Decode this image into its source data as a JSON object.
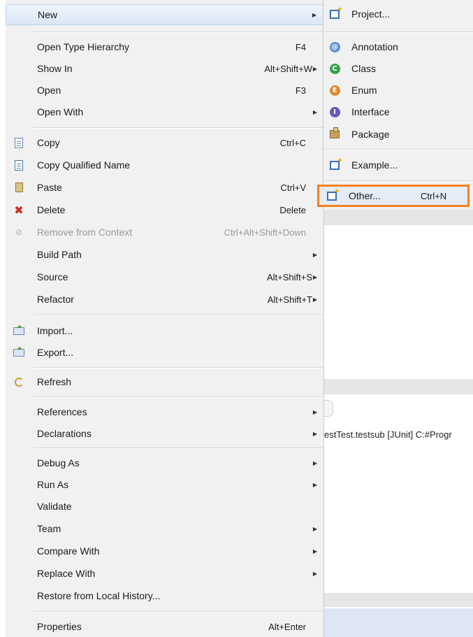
{
  "context_menu": {
    "items": [
      {
        "label": "New",
        "shortcut": "",
        "arrow": "▶",
        "icon": "",
        "highlighted": true
      },
      {
        "label": "Open Type Hierarchy",
        "shortcut": "F4",
        "arrow": "",
        "icon": ""
      },
      {
        "label": "Show In",
        "shortcut": "Alt+Shift+W",
        "arrow": "▶",
        "icon": ""
      },
      {
        "label": "Open",
        "shortcut": "F3",
        "arrow": "",
        "icon": ""
      },
      {
        "label": "Open With",
        "shortcut": "",
        "arrow": "▶",
        "icon": ""
      },
      {
        "label": "Copy",
        "shortcut": "Ctrl+C",
        "arrow": "",
        "icon": "copy-icon"
      },
      {
        "label": "Copy Qualified Name",
        "shortcut": "",
        "arrow": "",
        "icon": "copy-qualified-name-icon"
      },
      {
        "label": "Paste",
        "shortcut": "Ctrl+V",
        "arrow": "",
        "icon": "paste-icon"
      },
      {
        "label": "Delete",
        "shortcut": "Delete",
        "arrow": "",
        "icon": "delete-icon"
      },
      {
        "label": "Remove from Context",
        "shortcut": "Ctrl+Alt+Shift+Down",
        "arrow": "",
        "icon": "remove-context-icon",
        "disabled": true
      },
      {
        "label": "Build Path",
        "shortcut": "",
        "arrow": "▶",
        "icon": ""
      },
      {
        "label": "Source",
        "shortcut": "Alt+Shift+S",
        "arrow": "▶",
        "icon": ""
      },
      {
        "label": "Refactor",
        "shortcut": "Alt+Shift+T",
        "arrow": "▶",
        "icon": ""
      },
      {
        "label": "Import...",
        "shortcut": "",
        "arrow": "",
        "icon": "import-icon"
      },
      {
        "label": "Export...",
        "shortcut": "",
        "arrow": "",
        "icon": "export-icon"
      },
      {
        "label": "Refresh",
        "shortcut": "",
        "arrow": "",
        "icon": "refresh-icon"
      },
      {
        "label": "References",
        "shortcut": "",
        "arrow": "▶",
        "icon": ""
      },
      {
        "label": "Declarations",
        "shortcut": "",
        "arrow": "▶",
        "icon": ""
      },
      {
        "label": "Debug As",
        "shortcut": "",
        "arrow": "▶",
        "icon": ""
      },
      {
        "label": "Run As",
        "shortcut": "",
        "arrow": "▶",
        "icon": ""
      },
      {
        "label": "Validate",
        "shortcut": "",
        "arrow": "",
        "icon": ""
      },
      {
        "label": "Team",
        "shortcut": "",
        "arrow": "▶",
        "icon": ""
      },
      {
        "label": "Compare With",
        "shortcut": "",
        "arrow": "▶",
        "icon": ""
      },
      {
        "label": "Replace With",
        "shortcut": "",
        "arrow": "▶",
        "icon": ""
      },
      {
        "label": "Restore from Local History...",
        "shortcut": "",
        "arrow": "",
        "icon": ""
      },
      {
        "label": "Properties",
        "shortcut": "Alt+Enter",
        "arrow": "",
        "icon": ""
      }
    ]
  },
  "new_submenu": {
    "items": [
      {
        "label": "Project...",
        "shortcut": "",
        "icon": "new-project-icon"
      },
      {
        "label": "Annotation",
        "shortcut": "",
        "icon": "annotation-icon"
      },
      {
        "label": "Class",
        "shortcut": "",
        "icon": "class-icon"
      },
      {
        "label": "Enum",
        "shortcut": "",
        "icon": "enum-icon"
      },
      {
        "label": "Interface",
        "shortcut": "",
        "icon": "interface-icon"
      },
      {
        "label": "Package",
        "shortcut": "",
        "icon": "package-icon"
      },
      {
        "label": "Example...",
        "shortcut": "",
        "icon": "new-example-icon"
      },
      {
        "label": "Other...",
        "shortcut": "Ctrl+N",
        "icon": "new-other-icon",
        "highlighted": true
      }
    ]
  },
  "background": {
    "console_text": "estTest.testsub [JUnit] C:#Progr"
  },
  "colors": {
    "highlight_border": "#f58220",
    "menu_bg": "#f1f1f1",
    "selected_row": "#dbe7f7",
    "delete_icon": "#d0291c"
  }
}
